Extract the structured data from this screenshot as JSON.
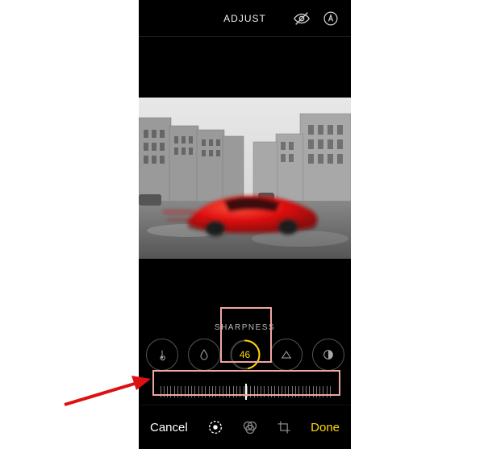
{
  "topbar": {
    "title": "ADJUST",
    "visibility_icon": "eye-off-icon",
    "auto_icon": "auto-circle-icon"
  },
  "adjust": {
    "param_label": "SHARPNESS",
    "active_value": "46",
    "dials": [
      {
        "name": "noise-reduction",
        "icon": "thermometer-icon"
      },
      {
        "name": "saturation",
        "icon": "droplet-icon"
      },
      {
        "name": "sharpness",
        "active": true,
        "value": "46"
      },
      {
        "name": "definition",
        "icon": "triangle-icon"
      },
      {
        "name": "vignette",
        "icon": "vignette-icon"
      }
    ],
    "slider_value": 46
  },
  "tools": {
    "adjust": "adjust-tool-icon",
    "filters": "filters-tool-icon",
    "crop": "crop-tool-icon"
  },
  "bottombar": {
    "cancel": "Cancel",
    "done": "Done"
  },
  "colors": {
    "accent": "#ffd60a",
    "highlight_box": "#f2a6a0",
    "arrow": "#d11"
  }
}
